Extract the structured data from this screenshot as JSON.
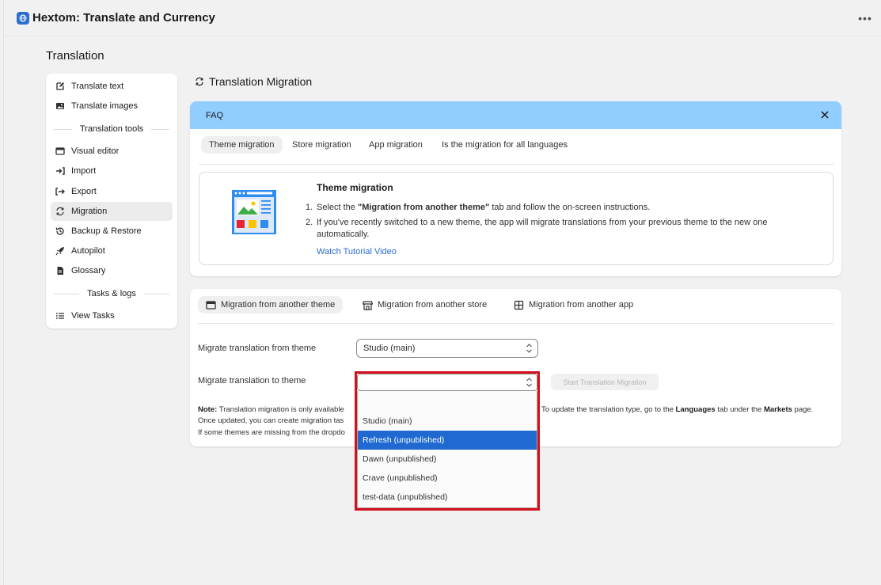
{
  "app": {
    "title": "Hextom: Translate and Currency",
    "more_icon": "more-horizontal-icon"
  },
  "page": {
    "title": "Translation"
  },
  "sidebar": {
    "items": [
      {
        "label": "Translate text",
        "icon": "edit-icon"
      },
      {
        "label": "Translate images",
        "icon": "image-icon"
      }
    ],
    "section_tools": "Translation tools",
    "tools": [
      {
        "label": "Visual editor",
        "icon": "window-icon"
      },
      {
        "label": "Import",
        "icon": "import-icon"
      },
      {
        "label": "Export",
        "icon": "export-icon"
      },
      {
        "label": "Migration",
        "icon": "sync-icon",
        "active": true
      },
      {
        "label": "Backup & Restore",
        "icon": "history-icon"
      },
      {
        "label": "Autopilot",
        "icon": "rocket-icon"
      },
      {
        "label": "Glossary",
        "icon": "document-icon"
      }
    ],
    "section_tasks": "Tasks & logs",
    "tasks": [
      {
        "label": "View Tasks",
        "icon": "list-icon"
      }
    ]
  },
  "main": {
    "title": "Translation Migration",
    "faq": {
      "label": "FAQ",
      "tabs": [
        "Theme migration",
        "Store migration",
        "App migration",
        "Is the migration for all languages"
      ],
      "active_tab": 0,
      "content": {
        "title": "Theme migration",
        "step1_num": "1.",
        "step1_pre": "Select the ",
        "step1_bold": "\"Migration from another theme\"",
        "step1_post": " tab and follow the on-screen instructions.",
        "step2_num": "2.",
        "step2_line1": "If you've recently switched to a new theme, the app will migrate translations from your previous theme to the new one",
        "step2_line2": "automatically.",
        "link": "Watch Tutorial Video"
      }
    },
    "migration": {
      "tabs": [
        {
          "label": "Migration from another theme",
          "icon": "theme-icon"
        },
        {
          "label": "Migration from another store",
          "icon": "store-icon"
        },
        {
          "label": "Migration from another app",
          "icon": "apps-icon"
        }
      ],
      "from_label": "Migrate translation from theme",
      "from_value": "Studio (main)",
      "to_label": "Migrate translation to theme",
      "to_value": "",
      "start_button": "Start Translation Migration",
      "note": {
        "bold": "Note:",
        "line1_a": " Translation migration is only available",
        "line1_b": "To update the translation type, go to the ",
        "languages": "Languages",
        "line1_c": " tab under the ",
        "markets": "Markets",
        "line1_d": " page.",
        "line2": "Once updated, you can create migration tas",
        "line3": "If some themes are missing from the dropdo"
      }
    },
    "dropdown": {
      "options": [
        "",
        "Studio (main)",
        "Refresh (unpublished)",
        "Dawn (unpublished)",
        "Crave (unpublished)",
        "test-data (unpublished)"
      ],
      "selected_index": 2
    }
  },
  "colors": {
    "faq_bg": "#91cdff",
    "link": "#2c6ecb",
    "highlight_outline": "#d40f1e",
    "option_selected": "#1f69d1"
  }
}
